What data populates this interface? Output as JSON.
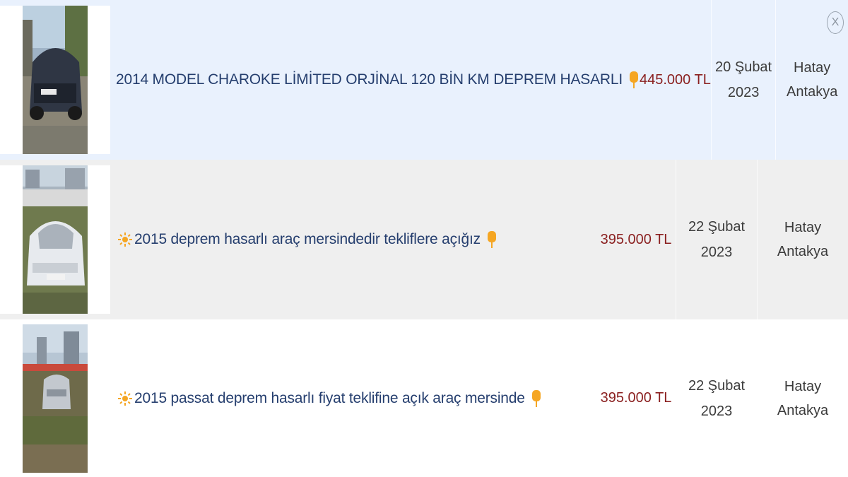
{
  "close_button": {
    "glyph": "X"
  },
  "listings": [
    {
      "title": "2014 MODEL CHAROKE LİMİTED ORJİNAL 120 BİN KM DEPREM HASARLI",
      "has_sun_badge": false,
      "price": "445.000 TL",
      "date_day": "20 Şubat",
      "date_year": "2023",
      "city": "Hatay",
      "district": "Antakya",
      "thumb_icon": "damaged-car-photo"
    },
    {
      "title": "2015 deprem hasarlı araç mersindedir tekliflere açığız",
      "has_sun_badge": true,
      "price": "395.000 TL",
      "date_day": "22 Şubat",
      "date_year": "2023",
      "city": "Hatay",
      "district": "Antakya",
      "thumb_icon": "damaged-car-photo"
    },
    {
      "title": "2015 passat deprem hasarlı fiyat teklifine açık araç mersinde",
      "has_sun_badge": true,
      "price": "395.000 TL",
      "date_day": "22 Şubat",
      "date_year": "2023",
      "city": "Hatay",
      "district": "Antakya",
      "thumb_icon": "damaged-car-photo"
    }
  ],
  "colors": {
    "row_highlight": "#e9f1fd",
    "row_alt": "#efefef",
    "title": "#253e6e",
    "price": "#8a1f1f",
    "badge": "#f5a623"
  }
}
